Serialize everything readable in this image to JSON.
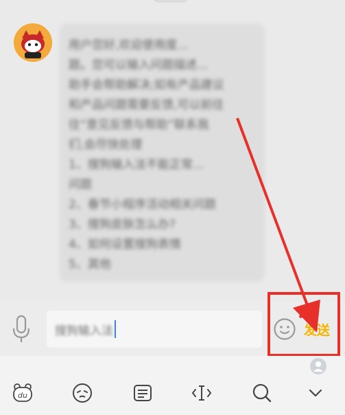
{
  "chat": {
    "message_lines": [
      "用户您好,欢迎使用度...",
      "题。您可以输入问题描述...",
      "助手会帮助解决;如有产品建议",
      "和产品问题需要反馈,可以前往",
      "往“意见反馈与帮助”联系我",
      "们,会尽快处理",
      "1、搜狗输入法不能正常...",
      "问题",
      "2、春节小程序活动相关问题",
      "3、搜狗皮肤怎么办?",
      "4、如何设置搜狗表情",
      "5、其他"
    ]
  },
  "input": {
    "text": "搜狗输入法",
    "send_label": "发送"
  },
  "icons": {
    "voice": "microphone-icon",
    "emoji": "emoji-icon",
    "keyboard_logo": "du-logo-icon",
    "face": "face-icon",
    "clipboard": "clipboard-icon",
    "cursor": "cursor-move-icon",
    "search": "search-icon",
    "collapse": "chevron-down-icon",
    "person": "person-icon"
  },
  "colors": {
    "accent": "#f4b400",
    "annotation": "#e8302b",
    "caret": "#3b82f6"
  }
}
